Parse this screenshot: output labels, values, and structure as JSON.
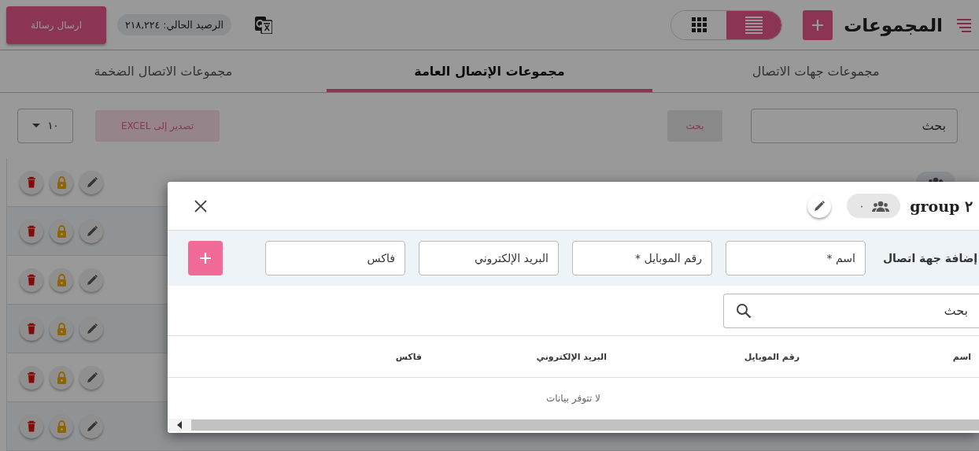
{
  "header": {
    "title": "المجموعات",
    "view_toggle": [
      {
        "kind": "list",
        "selected": true
      },
      {
        "kind": "grid",
        "selected": false
      }
    ],
    "balance": "الرصيد الحالي: ٢١٨,٢٢٤",
    "send_button": "ارسال رسالة"
  },
  "tabs": [
    {
      "label": "مجموعات جهات الاتصال",
      "selected": false
    },
    {
      "label": "مجموعات الإتصال العامة",
      "selected": true
    },
    {
      "label": "مجموعات الاتصال الضخمة",
      "selected": false
    }
  ],
  "toolbar": {
    "search_placeholder": "بحث",
    "search_button": "بحث",
    "export_button": "تصدير إلى EXCEL",
    "page_size": "١٠"
  },
  "rows": [
    {
      "kind": "group_chip"
    },
    {
      "kind": "group"
    },
    {
      "kind": "group"
    },
    {
      "kind": "group"
    },
    {
      "kind": "group"
    },
    {
      "kind": "group"
    }
  ],
  "dialog": {
    "title": "group ٢",
    "member_count": "٠",
    "add_label": "إضافة جهة اتصال",
    "fields": [
      {
        "placeholder": "اسم *"
      },
      {
        "placeholder": "رقم الموبايل *"
      },
      {
        "placeholder": "البريد الإلكتروني"
      },
      {
        "placeholder": "فاكس"
      }
    ],
    "search_placeholder": "بحث",
    "columns": [
      "اسم",
      "رقم الموبايل",
      "البريد الإلكتروني",
      "فاكس"
    ],
    "empty_text": "لا تتوفر بيانات"
  }
}
